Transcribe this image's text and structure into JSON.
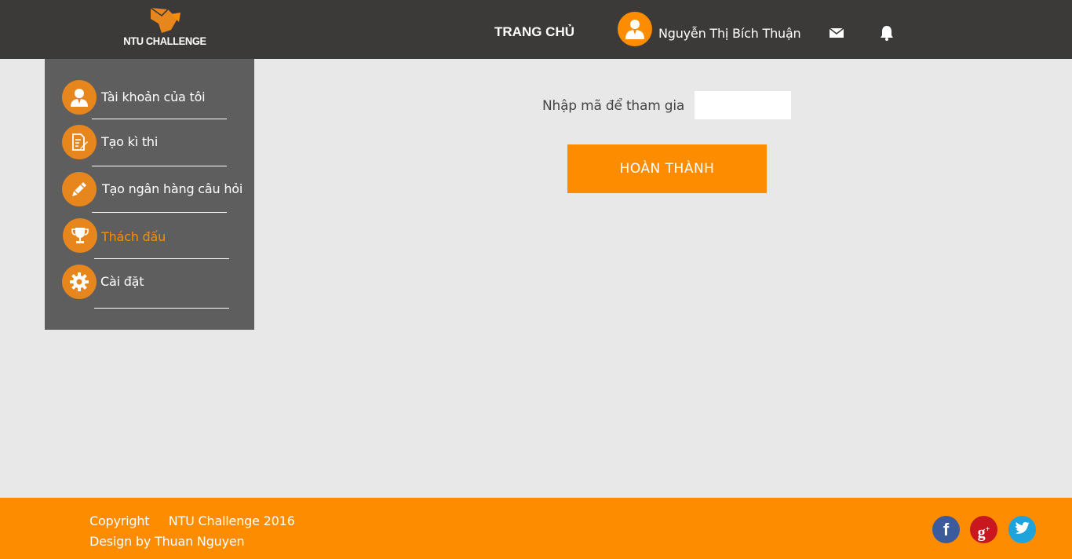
{
  "header": {
    "logo_text": "NTU CHALLENGE",
    "nav_home": "TRANG CHỦ",
    "user_name": "Nguyễn Thị Bích Thuận",
    "icons": [
      "user-avatar-icon",
      "mail-icon",
      "bell-icon"
    ]
  },
  "sidebar": {
    "items": [
      {
        "label": "Tài khoản của tôi",
        "icon": "user-icon",
        "active": false
      },
      {
        "label": "Tạo kì thi",
        "icon": "document-edit-icon",
        "active": false
      },
      {
        "label": "Tạo ngân hàng câu hỏi",
        "icon": "pencil-icon",
        "active": false
      },
      {
        "label": "Thách đấu",
        "icon": "trophy-icon",
        "active": true
      },
      {
        "label": "Cài đặt",
        "icon": "gear-icon",
        "active": false
      }
    ]
  },
  "main": {
    "join_label": "Nhập mã để tham gia",
    "join_value": "",
    "submit_label": "HOÀN THÀNH"
  },
  "footer": {
    "copyright": "Copyright     NTU Challenge 2016",
    "design_by": "Design by Thuan Nguyen",
    "social": [
      "facebook-icon",
      "google-plus-icon",
      "twitter-icon"
    ]
  },
  "colors": {
    "header_bg": "#3c3a39",
    "accent": "#fd8c00",
    "sidebar_bg": "#5e5e5e",
    "page_bg": "#e8e8e8",
    "facebook": "#3b5b9d",
    "google_plus": "#c8171e",
    "twitter": "#1ea3dc"
  }
}
